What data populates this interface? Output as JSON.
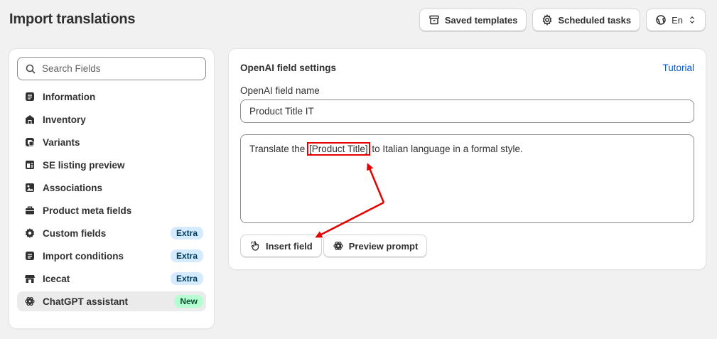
{
  "header": {
    "title": "Import translations",
    "saved_templates_label": "Saved templates",
    "scheduled_tasks_label": "Scheduled tasks",
    "language_label": "En"
  },
  "sidebar": {
    "search_placeholder": "Search Fields",
    "items": [
      {
        "label": "Information",
        "icon": "document-icon"
      },
      {
        "label": "Inventory",
        "icon": "warehouse-icon"
      },
      {
        "label": "Variants",
        "icon": "variants-icon"
      },
      {
        "label": "SE listing preview",
        "icon": "listing-preview-icon"
      },
      {
        "label": "Associations",
        "icon": "image-gallery-icon"
      },
      {
        "label": "Product meta fields",
        "icon": "briefcase-icon"
      },
      {
        "label": "Custom fields",
        "icon": "gear-icon",
        "badge": "Extra"
      },
      {
        "label": "Import conditions",
        "icon": "document-icon",
        "badge": "Extra"
      },
      {
        "label": "Icecat",
        "icon": "store-icon",
        "badge": "Extra"
      },
      {
        "label": "ChatGPT assistant",
        "icon": "openai-icon",
        "badge": "New",
        "active": true
      }
    ]
  },
  "main": {
    "title": "OpenAI field settings",
    "tutorial_label": "Tutorial",
    "field_name_label": "OpenAI field name",
    "field_name_value": "Product Title IT",
    "prompt_before": "Translate the ",
    "prompt_token": "[Product Title]",
    "prompt_after": " to Italian language in a formal style.",
    "insert_field_label": "Insert field",
    "preview_prompt_label": "Preview prompt"
  },
  "colors": {
    "annotation": "#e60000",
    "link": "#005bd3",
    "badge_extra_bg": "#d5ebff",
    "badge_new_bg": "#b4fed2"
  }
}
